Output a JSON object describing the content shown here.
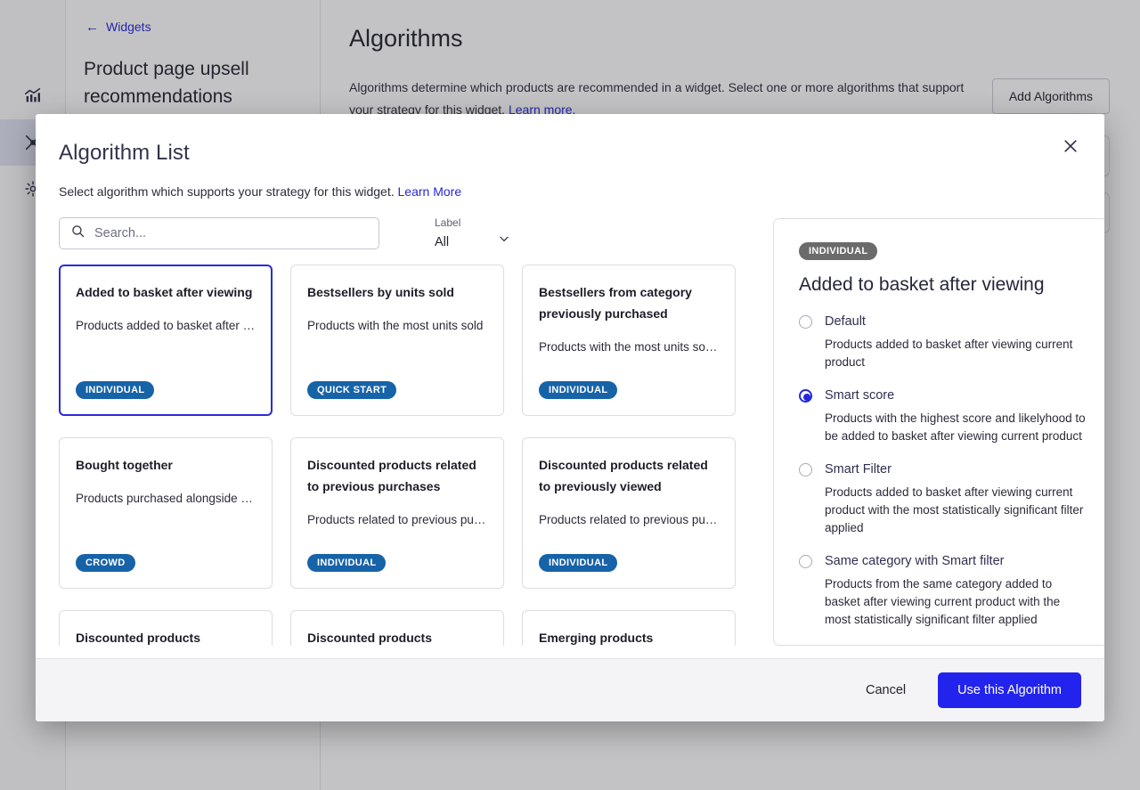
{
  "background": {
    "rail_icons": [
      {
        "name": "analytics-icon"
      },
      {
        "name": "widgets-icon"
      },
      {
        "name": "settings-gear-icon"
      }
    ],
    "back_link": "Widgets",
    "back_arrow": "←",
    "widget_title": "Product page upsell recommendations",
    "main_title": "Algorithms",
    "main_description": "Algorithms determine which products are recommended in a widget. Select one or more algorithms that support your strategy for this widget.",
    "main_description_link": "Learn more.",
    "add_algorithms_button": "Add Algorithms"
  },
  "modal": {
    "title": "Algorithm List",
    "close_icon": "close-icon",
    "subtitle": "Select algorithm which supports your strategy for this widget.",
    "subtitle_link": "Learn More",
    "search": {
      "placeholder": "Search...",
      "value": "",
      "icon": "search-icon"
    },
    "label_filter": {
      "label": "Label",
      "value": "All",
      "icon": "chevron-down-icon"
    },
    "cards": [
      {
        "title": "Added to basket after viewing",
        "description": "Products added to basket after vie…",
        "badge": "INDIVIDUAL",
        "selected": true
      },
      {
        "title": "Bestsellers by units sold",
        "description": "Products with the most units sold",
        "badge": "QUICK START",
        "selected": false
      },
      {
        "title": "Bestsellers from category previously purchased",
        "description": "Products with the most units sold f…",
        "badge": "INDIVIDUAL",
        "selected": false
      },
      {
        "title": "Bought together",
        "description": "Products purchased alongside the…",
        "badge": "CROWD",
        "selected": false
      },
      {
        "title": "Discounted products related to previous purchases",
        "description": "Products related to previous purch…",
        "badge": "INDIVIDUAL",
        "selected": false
      },
      {
        "title": "Discounted products related to previously viewed",
        "description": "Products related to previous purch…",
        "badge": "INDIVIDUAL",
        "selected": false
      },
      {
        "title": "Discounted products",
        "description": "",
        "badge": "",
        "selected": false
      },
      {
        "title": "Discounted products",
        "description": "",
        "badge": "",
        "selected": false
      },
      {
        "title": "Emerging products",
        "description": "",
        "badge": "",
        "selected": false
      }
    ],
    "detail": {
      "badge": "INDIVIDUAL",
      "title": "Added to basket after viewing",
      "options": [
        {
          "label": "Default",
          "description": "Products added to basket after viewing current product",
          "selected": false
        },
        {
          "label": "Smart score",
          "description": "Products with the highest score and likelyhood to be added to basket after viewing current product",
          "selected": true
        },
        {
          "label": "Smart Filter",
          "description": "Products added to basket after viewing current product with the most statistically significant filter applied",
          "selected": false
        },
        {
          "label": "Same category with Smart filter",
          "description": "Products from the same category added to basket after viewing current product with the most statistically significant filter applied",
          "selected": false
        }
      ]
    },
    "footer": {
      "cancel_label": "Cancel",
      "primary_label": "Use this Algorithm"
    }
  },
  "colors": {
    "primary_blue": "#2323ee",
    "selected_border": "#2b2bd8",
    "badge_blue": "#1763a8",
    "badge_grey": "#6b6b6b",
    "link_blue": "#2626d6"
  }
}
